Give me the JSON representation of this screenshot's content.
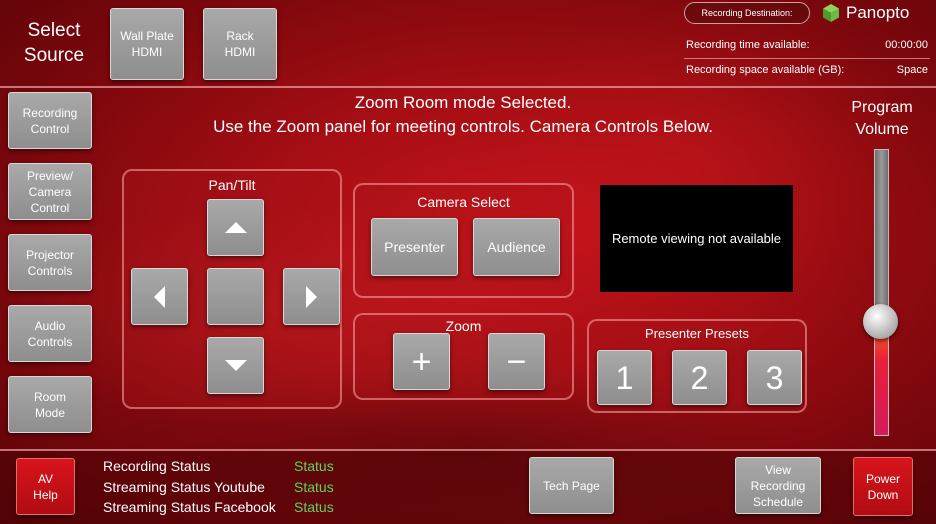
{
  "source": {
    "title_line1": "Select",
    "title_line2": "Source",
    "buttons": [
      {
        "line1": "Wall Plate",
        "line2": "HDMI"
      },
      {
        "line1": "Rack",
        "line2": "HDMI"
      }
    ]
  },
  "recording": {
    "destination_label": "Recording Destination:",
    "brand": "Panopto",
    "time_label": "Recording time available:",
    "time_value": "00:00:00",
    "space_label": "Recording space available (GB):",
    "space_value": "Space"
  },
  "sidebar": {
    "items": [
      {
        "line1": "Recording",
        "line2": "Control"
      },
      {
        "line1": "Preview/",
        "line2": "Camera",
        "line3": "Control"
      },
      {
        "line1": "Projector",
        "line2": "Controls"
      },
      {
        "line1": "Audio",
        "line2": "Controls"
      },
      {
        "line1": "Room",
        "line2": "Mode"
      }
    ]
  },
  "message": {
    "line1": "Zoom Room mode Selected.",
    "line2": "Use the Zoom panel for meeting controls. Camera Controls Below."
  },
  "pan_tilt": {
    "title": "Pan/Tilt"
  },
  "camera_select": {
    "title": "Camera Select",
    "presenter": "Presenter",
    "audience": "Audience"
  },
  "zoom": {
    "title": "Zoom",
    "plus": "+",
    "minus": "−"
  },
  "preview": {
    "text": "Remote viewing not available"
  },
  "presets": {
    "title": "Presenter Presets",
    "p1": "1",
    "p2": "2",
    "p3": "3"
  },
  "volume": {
    "line1": "Program",
    "line2": "Volume",
    "level": 0.4
  },
  "footer": {
    "av_help_line1": "AV",
    "av_help_line2": "Help",
    "statuses": [
      {
        "label": "Recording Status",
        "value": "Status"
      },
      {
        "label": "Streaming Status Youtube",
        "value": "Status"
      },
      {
        "label": "Streaming Status Facebook",
        "value": "Status"
      }
    ],
    "tech_page": "Tech Page",
    "schedule_line1": "View",
    "schedule_line2": "Recording",
    "schedule_line3": "Schedule",
    "power_line1": "Power",
    "power_line2": "Down"
  },
  "colors": {
    "background": "#a50e14",
    "button_gray": "#9c9c9c",
    "button_red": "#c8101a",
    "status_green": "#5fd35f",
    "panopto_green": "#6bbd45"
  }
}
